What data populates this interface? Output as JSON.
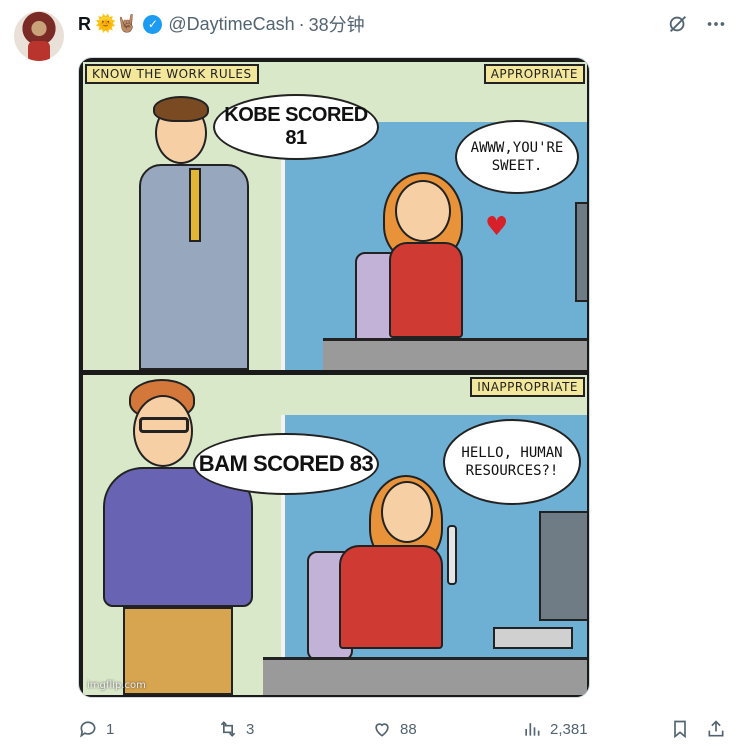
{
  "post": {
    "author_name": "R",
    "author_emojis": "🌞🤘🏽",
    "handle": "@DaytimeCash",
    "separator": "·",
    "time": "38分钟"
  },
  "meme": {
    "panel1": {
      "caption_left": "KNOW THE WORK RULES",
      "caption_right": "APPROPRIATE",
      "speech_man": "KOBE SCORED 81",
      "speech_woman_line1": "AWWW,YOU'RE",
      "speech_woman_line2": "SWEET."
    },
    "panel2": {
      "caption_right": "INAPPROPRIATE",
      "speech_man": "BAM SCORED 83",
      "speech_woman_line1": "HELLO, HUMAN",
      "speech_woman_line2": "RESOURCES?!"
    },
    "watermark": "imgflip.com"
  },
  "actions": {
    "replies": "1",
    "reposts": "3",
    "likes": "88",
    "views": "2,381"
  },
  "icons": {
    "grok": "grok-icon",
    "more": "more-icon",
    "reply": "reply-icon",
    "repost": "repost-icon",
    "like": "heart-icon",
    "views": "views-icon",
    "bookmark": "bookmark-icon",
    "share": "share-icon"
  },
  "colors": {
    "verified": "#1d9bf0",
    "secondary_text": "#536471",
    "caption_bg": "#f3e79b",
    "heart": "#d6202a"
  }
}
